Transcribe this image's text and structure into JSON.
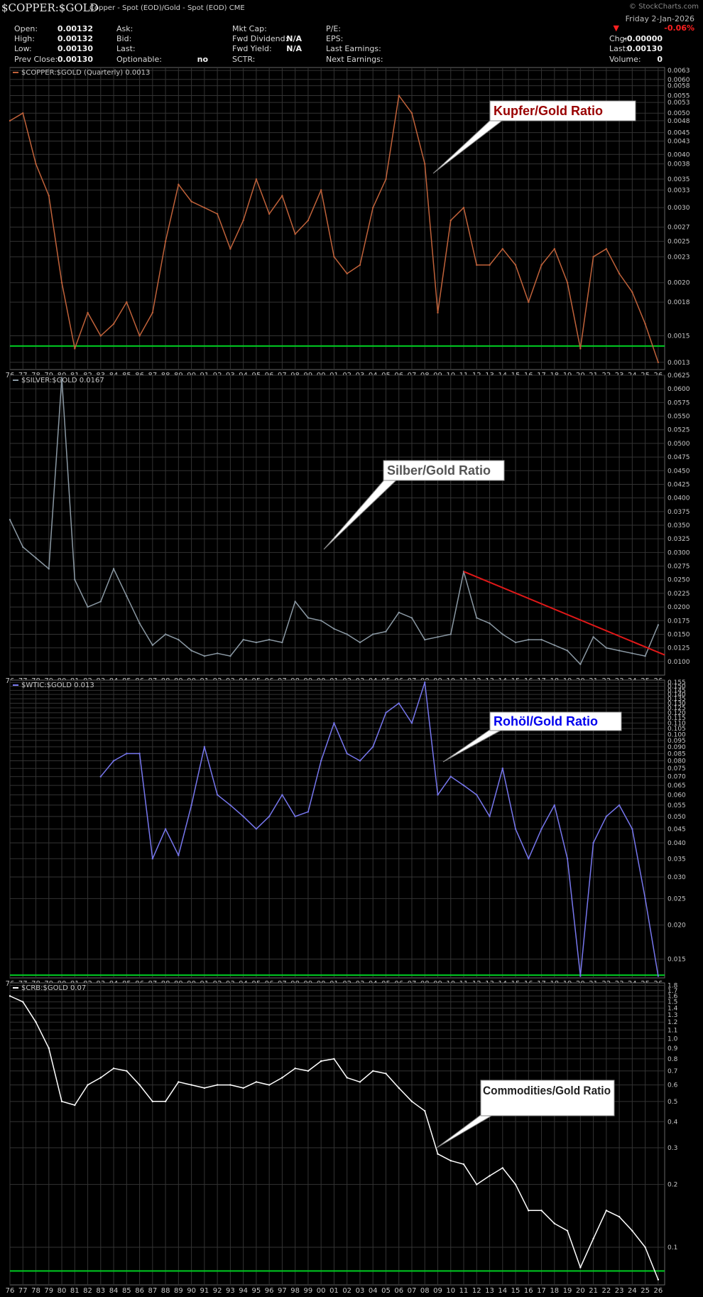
{
  "header": {
    "symbol": "$COPPER:$GOLD",
    "subtitle": "Copper - Spot (EOD)/Gold - Spot (EOD)  CME",
    "brand": "© StockCharts.com",
    "date": "Friday  2-Jan-2026",
    "change_pct": "-0.06%",
    "change_arrow": "▼",
    "col1": [
      {
        "label": "Open:",
        "value": "0.00132"
      },
      {
        "label": "High:",
        "value": "0.00132"
      },
      {
        "label": "Low:",
        "value": "0.00130"
      },
      {
        "label": "Prev Close:",
        "value": "0.00130"
      }
    ],
    "col2": [
      {
        "label": "Ask:",
        "value": ""
      },
      {
        "label": "Bid:",
        "value": ""
      },
      {
        "label": "Last:",
        "value": ""
      },
      {
        "label": "Optionable:",
        "value": "no"
      }
    ],
    "col3": [
      {
        "label": "Mkt Cap:",
        "value": ""
      },
      {
        "label": "Fwd Dividend:",
        "value": "N/A"
      },
      {
        "label": "Fwd Yield:",
        "value": "N/A"
      },
      {
        "label": "SCTR:",
        "value": ""
      }
    ],
    "col4": [
      {
        "label": "P/E:",
        "value": ""
      },
      {
        "label": "EPS:",
        "value": ""
      },
      {
        "label": "Last Earnings:",
        "value": ""
      },
      {
        "label": "Next Earnings:",
        "value": ""
      }
    ],
    "col5": [
      {
        "label": "Chg:",
        "value": "-0.00000"
      },
      {
        "label": "Last:",
        "value": "0.00130"
      },
      {
        "label": "Volume:",
        "value": "0"
      }
    ]
  },
  "colors": {
    "copper": "#c0623a",
    "silver": "#8a98a3",
    "oil": "#7777ee",
    "crb": "#ffffff",
    "support": "#00cc22",
    "trend": "#e01818",
    "grid": "#333333"
  },
  "x_axis": {
    "ticks": [
      "76",
      "77",
      "78",
      "79",
      "80",
      "81",
      "82",
      "83",
      "84",
      "85",
      "86",
      "87",
      "88",
      "89",
      "90",
      "91",
      "92",
      "93",
      "94",
      "95",
      "96",
      "97",
      "98",
      "99",
      "00",
      "01",
      "02",
      "03",
      "04",
      "05",
      "06",
      "07",
      "08",
      "09",
      "10",
      "11",
      "12",
      "13",
      "14",
      "15",
      "16",
      "17",
      "18",
      "19",
      "20",
      "21",
      "22",
      "23",
      "24",
      "25",
      "26"
    ]
  },
  "chart_data": [
    {
      "type": "line",
      "title": "$COPPER:$GOLD (Quarterly) 0.0013",
      "annotation": "Kupfer/Gold Ratio",
      "annotation_color": "#990000",
      "scale": "log",
      "ylim": [
        0.00125,
        0.0064
      ],
      "yticks": [
        "0.0063",
        "0.0060",
        "0.0058",
        "0.0055",
        "0.0053",
        "0.0050",
        "0.0048",
        "0.0045",
        "0.0043",
        "0.0040",
        "0.0038",
        "0.0035",
        "0.0033",
        "0.0030",
        "0.0027",
        "0.0025",
        "0.0023",
        "0.0020",
        "0.0018",
        "0.0015",
        "0.0013"
      ],
      "support_level": 0.00142,
      "x": [
        1976,
        1977,
        1978,
        1979,
        1980,
        1981,
        1982,
        1983,
        1984,
        1985,
        1986,
        1987,
        1988,
        1989,
        1990,
        1991,
        1992,
        1993,
        1994,
        1995,
        1996,
        1997,
        1998,
        1999,
        2000,
        2001,
        2002,
        2003,
        2004,
        2005,
        2006,
        2007,
        2008,
        2009,
        2010,
        2011,
        2012,
        2013,
        2014,
        2015,
        2016,
        2017,
        2018,
        2019,
        2020,
        2021,
        2022,
        2023,
        2024,
        2025,
        2026
      ],
      "values": [
        0.0048,
        0.005,
        0.0038,
        0.0032,
        0.002,
        0.0014,
        0.0017,
        0.0015,
        0.0016,
        0.0018,
        0.0015,
        0.0017,
        0.0025,
        0.0034,
        0.0031,
        0.003,
        0.0029,
        0.0024,
        0.0028,
        0.0035,
        0.0029,
        0.0032,
        0.0026,
        0.0028,
        0.0033,
        0.0023,
        0.0021,
        0.0022,
        0.003,
        0.0035,
        0.0055,
        0.005,
        0.0038,
        0.0017,
        0.0028,
        0.003,
        0.0022,
        0.0022,
        0.0024,
        0.0022,
        0.0018,
        0.0022,
        0.0024,
        0.002,
        0.0014,
        0.0023,
        0.0024,
        0.0021,
        0.0019,
        0.0016,
        0.0013
      ]
    },
    {
      "type": "line",
      "title": "$SILVER:$GOLD 0.0167",
      "annotation": "Silber/Gold Ratio",
      "annotation_color": "#555555",
      "scale": "linear",
      "ylim": [
        0.0075,
        0.0625
      ],
      "yticks": [
        "0.0625",
        "0.0600",
        "0.0575",
        "0.0550",
        "0.0525",
        "0.0500",
        "0.0475",
        "0.0450",
        "0.0425",
        "0.0400",
        "0.0375",
        "0.0350",
        "0.0325",
        "0.0300",
        "0.0275",
        "0.0250",
        "0.0225",
        "0.0200",
        "0.0175",
        "0.0150",
        "0.0125",
        "0.0100"
      ],
      "trendline": [
        [
          2011.0,
          0.0265
        ],
        [
          2026.5,
          0.0112
        ]
      ],
      "x": [
        1976,
        1977,
        1978,
        1979,
        1980,
        1981,
        1982,
        1983,
        1984,
        1985,
        1986,
        1987,
        1988,
        1989,
        1990,
        1991,
        1992,
        1993,
        1994,
        1995,
        1996,
        1997,
        1998,
        1999,
        2000,
        2001,
        2002,
        2003,
        2004,
        2005,
        2006,
        2007,
        2008,
        2009,
        2010,
        2011,
        2012,
        2013,
        2014,
        2015,
        2016,
        2017,
        2018,
        2019,
        2020,
        2021,
        2022,
        2023,
        2024,
        2025,
        2026
      ],
      "values": [
        0.036,
        0.031,
        0.029,
        0.027,
        0.062,
        0.025,
        0.02,
        0.021,
        0.027,
        0.022,
        0.017,
        0.013,
        0.015,
        0.014,
        0.012,
        0.011,
        0.0115,
        0.011,
        0.014,
        0.0135,
        0.014,
        0.0135,
        0.021,
        0.018,
        0.0175,
        0.016,
        0.015,
        0.0135,
        0.015,
        0.0155,
        0.019,
        0.018,
        0.014,
        0.0145,
        0.015,
        0.0265,
        0.018,
        0.017,
        0.015,
        0.0135,
        0.014,
        0.014,
        0.013,
        0.012,
        0.0095,
        0.0145,
        0.0125,
        0.012,
        0.0115,
        0.011,
        0.0167
      ]
    },
    {
      "type": "line",
      "title": "$WTIC:$GOLD 0.013",
      "annotation": "Rohöl/Gold Ratio",
      "annotation_color": "#0000ee",
      "scale": "log",
      "ylim": [
        0.0128,
        0.158
      ],
      "yticks": [
        "0.155",
        "0.150",
        "0.145",
        "0.140",
        "0.135",
        "0.130",
        "0.125",
        "0.120",
        "0.115",
        "0.110",
        "0.105",
        "0.100",
        "0.095",
        "0.090",
        "0.085",
        "0.080",
        "0.075",
        "0.070",
        "0.065",
        "0.060",
        "0.055",
        "0.050",
        "0.045",
        "0.040",
        "0.035",
        "0.030",
        "0.025",
        "0.020",
        "0.015"
      ],
      "support_level": 0.0131,
      "x": [
        1983,
        1984,
        1985,
        1986,
        1987,
        1988,
        1989,
        1990,
        1991,
        1992,
        1993,
        1994,
        1995,
        1996,
        1997,
        1998,
        1999,
        2000,
        2001,
        2002,
        2003,
        2004,
        2005,
        2006,
        2007,
        2008,
        2009,
        2010,
        2011,
        2012,
        2013,
        2014,
        2015,
        2016,
        2017,
        2018,
        2019,
        2020,
        2021,
        2022,
        2023,
        2024,
        2025,
        2026
      ],
      "values": [
        0.07,
        0.08,
        0.085,
        0.085,
        0.035,
        0.045,
        0.036,
        0.055,
        0.09,
        0.06,
        0.055,
        0.05,
        0.045,
        0.05,
        0.06,
        0.05,
        0.052,
        0.08,
        0.11,
        0.085,
        0.08,
        0.09,
        0.12,
        0.13,
        0.11,
        0.155,
        0.06,
        0.07,
        0.065,
        0.06,
        0.05,
        0.075,
        0.045,
        0.035,
        0.045,
        0.055,
        0.035,
        0.013,
        0.04,
        0.05,
        0.055,
        0.045,
        0.025,
        0.013
      ]
    },
    {
      "type": "line",
      "title": "$CRB:$GOLD 0.07",
      "annotation": "Commodities/Gold Ratio",
      "annotation_color": "#222222",
      "scale": "log",
      "ylim": [
        0.066,
        1.85
      ],
      "yticks": [
        "1.8",
        "1.7",
        "1.6",
        "1.5",
        "1.4",
        "1.3",
        "1.2",
        "1.1",
        "1.0",
        "0.9",
        "0.8",
        "0.7",
        "0.6",
        "0.5",
        "0.4",
        "0.3",
        "0.2",
        "0.1"
      ],
      "support_level": 0.077,
      "x": [
        1976,
        1977,
        1978,
        1979,
        1980,
        1981,
        1982,
        1983,
        1984,
        1985,
        1986,
        1987,
        1988,
        1989,
        1990,
        1991,
        1992,
        1993,
        1994,
        1995,
        1996,
        1997,
        1998,
        1999,
        2000,
        2001,
        2002,
        2003,
        2004,
        2005,
        2006,
        2007,
        2008,
        2009,
        2010,
        2011,
        2012,
        2013,
        2014,
        2015,
        2016,
        2017,
        2018,
        2019,
        2020,
        2021,
        2022,
        2023,
        2024,
        2025,
        2026
      ],
      "values": [
        1.6,
        1.5,
        1.2,
        0.9,
        0.5,
        0.48,
        0.6,
        0.65,
        0.72,
        0.7,
        0.6,
        0.5,
        0.5,
        0.62,
        0.6,
        0.58,
        0.6,
        0.6,
        0.58,
        0.62,
        0.6,
        0.65,
        0.72,
        0.7,
        0.78,
        0.8,
        0.65,
        0.62,
        0.7,
        0.68,
        0.58,
        0.5,
        0.45,
        0.28,
        0.26,
        0.25,
        0.2,
        0.22,
        0.24,
        0.2,
        0.15,
        0.15,
        0.13,
        0.12,
        0.08,
        0.11,
        0.15,
        0.14,
        0.12,
        0.1,
        0.07
      ]
    }
  ]
}
